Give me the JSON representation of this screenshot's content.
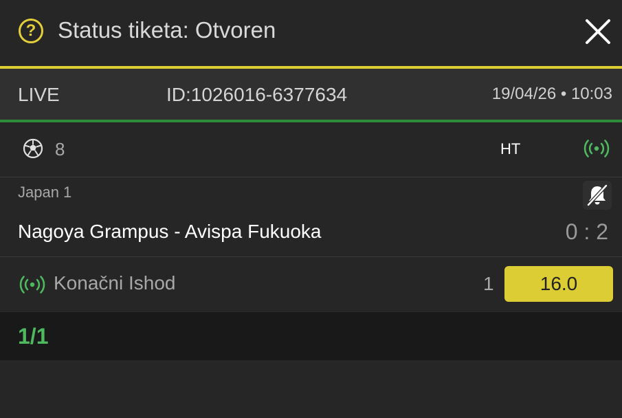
{
  "header": {
    "help_icon": "question-circle-icon",
    "help_glyph": "?",
    "title": "Status tiketa: Otvoren",
    "close_icon": "close-icon"
  },
  "meta": {
    "live": "LIVE",
    "ticket_id": "ID:1026016-6377634",
    "datetime": "19/04/26 • 10:03"
  },
  "sport": {
    "icon": "soccer-ball-icon",
    "count": "8",
    "status": "HT",
    "live_icon": "live-broadcast-icon"
  },
  "match": {
    "league": "Japan 1",
    "name": "Nagoya Grampus - Avispa Fukuoka",
    "score": "0 : 2",
    "notification_icon": "bell-off-icon"
  },
  "bet": {
    "live_icon": "live-broadcast-icon",
    "market": "Konačni Ishod",
    "pick": "1",
    "odds": "16.0"
  },
  "footer": {
    "counter": "1/1"
  },
  "colors": {
    "accent_yellow": "#dccd34",
    "accent_green": "#4fb95f",
    "background": "#262626"
  }
}
